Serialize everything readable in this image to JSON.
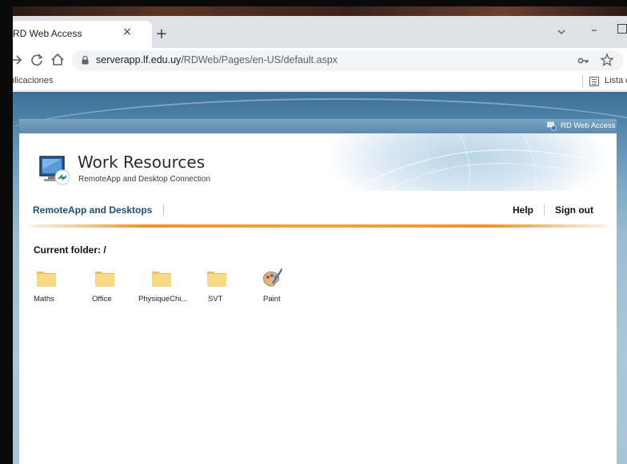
{
  "browser": {
    "tab_title": "RD Web Access",
    "tab_close": "×",
    "new_tab": "+",
    "minimize": "–",
    "url_host": "serverapp.lf.edu.uy",
    "url_path": "/RDWeb/Pages/en-US/default.aspx",
    "bookmarks_left": "plicaciones",
    "bookmarks_right": "Lista d",
    "icons": [
      "back-arrow-icon",
      "reload-icon",
      "home-icon",
      "lock-icon",
      "key-icon",
      "star-icon",
      "tab-search-icon",
      "reading-list-icon"
    ]
  },
  "rdweb": {
    "top_label": "RD Web Access",
    "title": "Work Resources",
    "subtitle": "RemoteApp and Desktop Connection",
    "nav": {
      "remoteapp": "RemoteApp and Desktops",
      "help": "Help",
      "signout": "Sign out"
    },
    "current_folder": "Current folder: /",
    "resources": [
      {
        "label": "Maths",
        "type": "folder"
      },
      {
        "label": "Office",
        "type": "folder"
      },
      {
        "label": "PhysiqueChi...",
        "type": "folder"
      },
      {
        "label": "SVT",
        "type": "folder"
      },
      {
        "label": "Paint",
        "type": "app"
      }
    ],
    "colors": {
      "nav_link": "#1f4e79",
      "accent_rule": "#f0a640",
      "folder": "#f5d37a",
      "page_bg": "#8fb4cc"
    }
  }
}
